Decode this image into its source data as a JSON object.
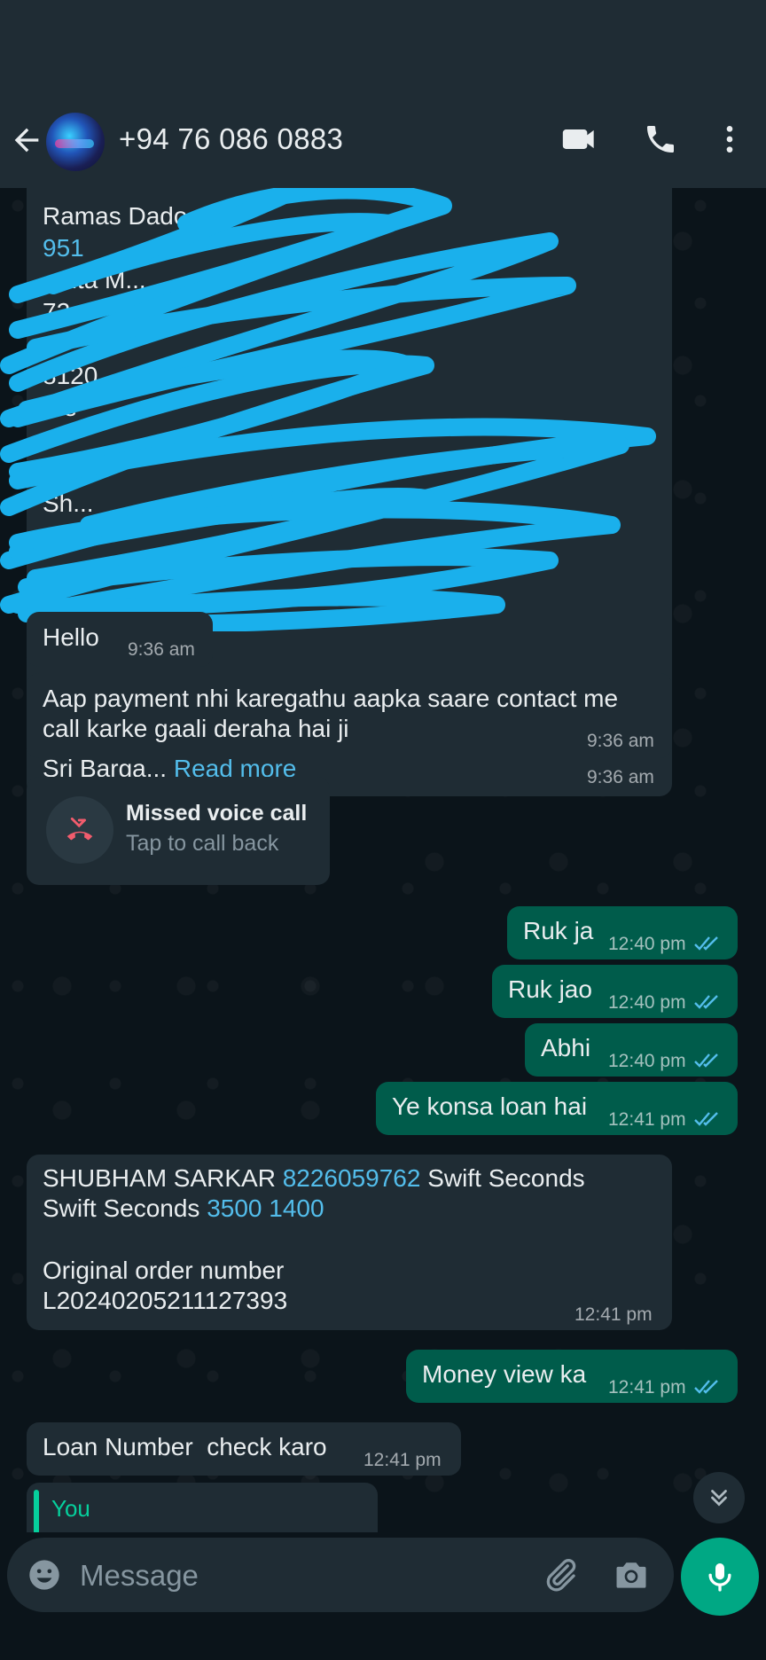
{
  "header": {
    "contact_name": "+94 76 086 0883",
    "icons": [
      "back-arrow-icon",
      "video-call-icon",
      "voice-call-icon",
      "more-options-icon"
    ]
  },
  "messages": {
    "forwarded": {
      "lines": [
        "Ramas Dado",
        "951",
        "...nta M...",
        "72...",
        "...",
        "8120...",
        "...e",
        "",
        "...96",
        "Sh..."
      ],
      "last_line": "Sri Barga...",
      "read_more": "Read more",
      "time": "9:36 am"
    },
    "hello": {
      "text": "Hello",
      "time": "9:36 am"
    },
    "payment": {
      "text_line1": "Aap payment nhi karegathu aapka saare contact me",
      "text_line2": "call karke gaali deraha hai ji",
      "time": "9:36 am"
    },
    "missed_call": {
      "title": "Missed voice call",
      "subtitle": "Tap to call back"
    },
    "out1": {
      "text": "Ruk ja",
      "time": "12:40 pm"
    },
    "out2": {
      "text": "Ruk jao",
      "time": "12:40 pm"
    },
    "out3": {
      "text": "Abhi",
      "time": "12:40 pm"
    },
    "out4": {
      "text": "Ye konsa loan hai",
      "time": "12:41 pm"
    },
    "details": {
      "name": "SHUBHAM SARKAR ",
      "phone": "8226059762",
      "after_phone": "  Swift Seconds",
      "line2_prefix": "Swift Seconds ",
      "amounts": "3500 1400",
      "line3": "Original order number",
      "line4": "L20240205211127393",
      "time": "12:41 pm"
    },
    "out5": {
      "text": "Money view ka",
      "time": "12:41 pm"
    },
    "loan": {
      "text": "Loan Number  check karo",
      "time": "12:41 pm"
    },
    "quoted": {
      "author": "You"
    }
  },
  "composer": {
    "placeholder": "Message",
    "icons": [
      "emoji-icon",
      "attach-icon",
      "camera-icon",
      "mic-icon"
    ]
  },
  "colors": {
    "background": "#0b141a",
    "header": "#1f2c34",
    "incoming": "#1f2c34",
    "outgoing": "#005c4b",
    "accent": "#00a884",
    "link": "#53bdeb",
    "read_ticks": "#53bdeb",
    "redaction": "#1ab0ec"
  }
}
